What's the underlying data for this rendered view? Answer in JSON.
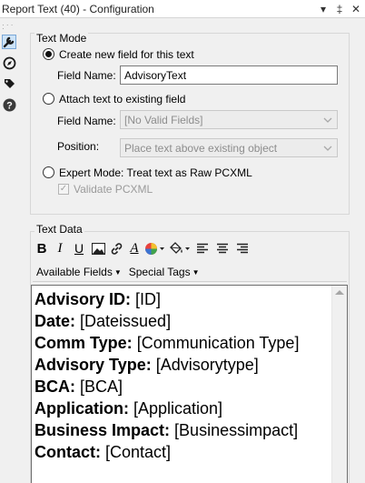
{
  "window": {
    "title": "Report Text (40) - Configuration",
    "controls": [
      "▾",
      "‡",
      "✕"
    ]
  },
  "text_mode": {
    "heading": "Text Mode",
    "option_create": "Create new field for this text",
    "field_name_label": "Field Name:",
    "field_name_value": "AdvisoryText",
    "option_attach": "Attach text to existing field",
    "attach_field_name_label": "Field Name:",
    "attach_field_name_value": "[No Valid Fields]",
    "position_label": "Position:",
    "position_value": "Place text above existing object",
    "option_expert": "Expert Mode: Treat text as Raw PCXML",
    "validate_label": "Validate PCXML",
    "selected": "create"
  },
  "text_data": {
    "heading": "Text Data",
    "menu_available_fields": "Available Fields",
    "menu_special_tags": "Special Tags",
    "lines": [
      {
        "bold": "Advisory ID:",
        "rest": " [ID]"
      },
      {
        "bold": "Date:",
        "rest": " [Dateissued]"
      },
      {
        "bold": "Comm Type:",
        "rest": " [Communication Type]"
      },
      {
        "bold": "Advisory Type:",
        "rest": " [Advisorytype]"
      },
      {
        "bold": "BCA:",
        "rest": " [BCA]"
      },
      {
        "bold": "Application:",
        "rest": " [Application]"
      },
      {
        "bold": "Business Impact:",
        "rest": " [Businessimpact]"
      },
      {
        "bold": "Contact:",
        "rest": " [Contact]"
      }
    ]
  },
  "toolbar": {
    "bold_glyph": "B",
    "italic_glyph": "I",
    "underline_glyph": "U",
    "font_glyph": "A"
  },
  "colors": {
    "selected_tool_bg": "#cde3f7",
    "help_icon_bg": "#3a3a3a"
  },
  "tools": [
    "wrench-icon",
    "compass-icon",
    "tag-icon",
    "help-icon"
  ]
}
